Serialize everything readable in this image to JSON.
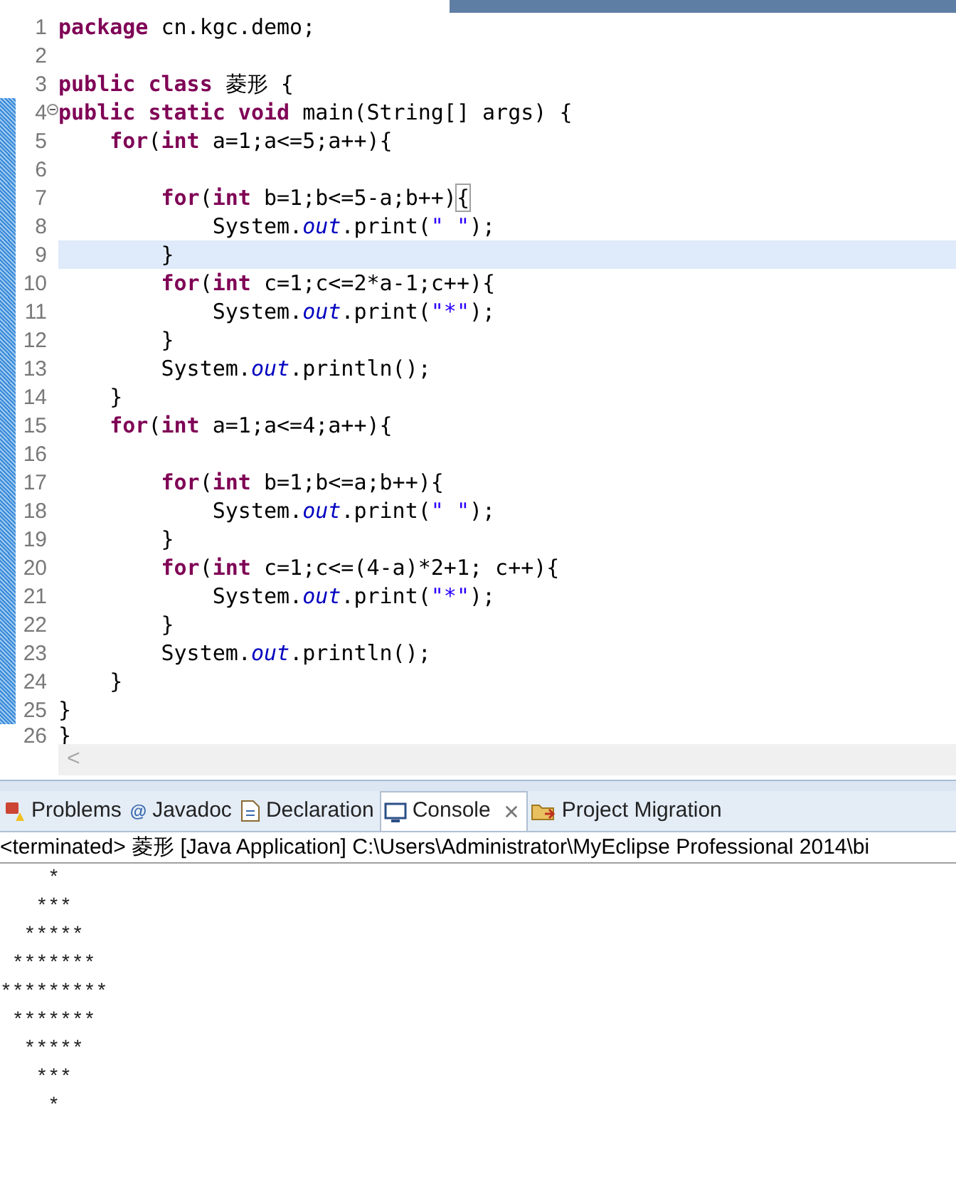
{
  "editor": {
    "lines": [
      {
        "number": "1",
        "current": false,
        "fold": false,
        "marked": false,
        "segments": [
          {
            "kind": "keyword",
            "text": "package"
          },
          {
            "kind": "plain",
            "text": " cn.kgc.demo;"
          }
        ]
      },
      {
        "number": "2",
        "current": false,
        "fold": false,
        "marked": false
      },
      {
        "number": "3",
        "current": false,
        "fold": false,
        "marked": false,
        "segments": [
          {
            "kind": "keyword",
            "text": "public class"
          },
          {
            "kind": "plain",
            "text": " 菱形 {"
          }
        ]
      },
      {
        "number": "4",
        "current": false,
        "fold": true,
        "marked": true,
        "segments": [
          {
            "kind": "keyword",
            "text": "public static void"
          },
          {
            "kind": "plain",
            "text": " main(String[] args) {"
          }
        ]
      },
      {
        "number": "5",
        "current": false,
        "fold": false,
        "marked": true,
        "segments": [
          {
            "kind": "keyword",
            "text": "    for"
          },
          {
            "kind": "plain",
            "text": "("
          },
          {
            "kind": "keyword",
            "text": "int"
          },
          {
            "kind": "plain",
            "text": " a=1;a<=5;a++){"
          }
        ]
      },
      {
        "number": "6",
        "current": false,
        "fold": false,
        "marked": true
      },
      {
        "number": "7",
        "current": false,
        "fold": false,
        "marked": true,
        "segments": [
          {
            "kind": "keyword",
            "text": "        for"
          },
          {
            "kind": "plain",
            "text": "("
          },
          {
            "kind": "keyword",
            "text": "int"
          },
          {
            "kind": "plain",
            "text": " b=1;b<=5-a;b++)"
          },
          {
            "kind": "bracket",
            "text": "{"
          }
        ]
      },
      {
        "number": "8",
        "current": false,
        "fold": false,
        "marked": true,
        "segments": [
          {
            "kind": "plain",
            "text": "            System."
          },
          {
            "kind": "field",
            "text": "out"
          },
          {
            "kind": "plain",
            "text": ".print("
          },
          {
            "kind": "string",
            "text": "\" \""
          },
          {
            "kind": "plain",
            "text": ");"
          }
        ]
      },
      {
        "number": "9",
        "current": true,
        "fold": false,
        "marked": true,
        "segments": [
          {
            "kind": "plain",
            "text": "        }"
          }
        ]
      },
      {
        "number": "10",
        "current": false,
        "fold": false,
        "marked": true,
        "segments": [
          {
            "kind": "keyword",
            "text": "        for"
          },
          {
            "kind": "plain",
            "text": "("
          },
          {
            "kind": "keyword",
            "text": "int"
          },
          {
            "kind": "plain",
            "text": " c=1;c<=2*a-1;c++){"
          }
        ]
      },
      {
        "number": "11",
        "current": false,
        "fold": false,
        "marked": true,
        "segments": [
          {
            "kind": "plain",
            "text": "            System."
          },
          {
            "kind": "field",
            "text": "out"
          },
          {
            "kind": "plain",
            "text": ".print("
          },
          {
            "kind": "string",
            "text": "\"*\""
          },
          {
            "kind": "plain",
            "text": ");"
          }
        ]
      },
      {
        "number": "12",
        "current": false,
        "fold": false,
        "marked": true,
        "segments": [
          {
            "kind": "plain",
            "text": "        }"
          }
        ]
      },
      {
        "number": "13",
        "current": false,
        "fold": false,
        "marked": true,
        "segments": [
          {
            "kind": "plain",
            "text": "        System."
          },
          {
            "kind": "field",
            "text": "out"
          },
          {
            "kind": "plain",
            "text": ".println();"
          }
        ]
      },
      {
        "number": "14",
        "current": false,
        "fold": false,
        "marked": true,
        "segments": [
          {
            "kind": "plain",
            "text": "    }"
          }
        ]
      },
      {
        "number": "15",
        "current": false,
        "fold": false,
        "marked": true,
        "segments": [
          {
            "kind": "keyword",
            "text": "    for"
          },
          {
            "kind": "plain",
            "text": "("
          },
          {
            "kind": "keyword",
            "text": "int"
          },
          {
            "kind": "plain",
            "text": " a=1;a<=4;a++){"
          }
        ]
      },
      {
        "number": "16",
        "current": false,
        "fold": false,
        "marked": true
      },
      {
        "number": "17",
        "current": false,
        "fold": false,
        "marked": true,
        "segments": [
          {
            "kind": "keyword",
            "text": "        for"
          },
          {
            "kind": "plain",
            "text": "("
          },
          {
            "kind": "keyword",
            "text": "int"
          },
          {
            "kind": "plain",
            "text": " b=1;b<=a;b++){"
          }
        ]
      },
      {
        "number": "18",
        "current": false,
        "fold": false,
        "marked": true,
        "segments": [
          {
            "kind": "plain",
            "text": "            System."
          },
          {
            "kind": "field",
            "text": "out"
          },
          {
            "kind": "plain",
            "text": ".print("
          },
          {
            "kind": "string",
            "text": "\" \""
          },
          {
            "kind": "plain",
            "text": ");"
          }
        ]
      },
      {
        "number": "19",
        "current": false,
        "fold": false,
        "marked": true,
        "segments": [
          {
            "kind": "plain",
            "text": "        }"
          }
        ]
      },
      {
        "number": "20",
        "current": false,
        "fold": false,
        "marked": true,
        "segments": [
          {
            "kind": "keyword",
            "text": "        for"
          },
          {
            "kind": "plain",
            "text": "("
          },
          {
            "kind": "keyword",
            "text": "int"
          },
          {
            "kind": "plain",
            "text": " c=1;c<=(4-a)*2+1; c++){"
          }
        ]
      },
      {
        "number": "21",
        "current": false,
        "fold": false,
        "marked": true,
        "segments": [
          {
            "kind": "plain",
            "text": "            System."
          },
          {
            "kind": "field",
            "text": "out"
          },
          {
            "kind": "plain",
            "text": ".print("
          },
          {
            "kind": "string",
            "text": "\"*\""
          },
          {
            "kind": "plain",
            "text": ");"
          }
        ]
      },
      {
        "number": "22",
        "current": false,
        "fold": false,
        "marked": true,
        "segments": [
          {
            "kind": "plain",
            "text": "        }"
          }
        ]
      },
      {
        "number": "23",
        "current": false,
        "fold": false,
        "marked": true,
        "segments": [
          {
            "kind": "plain",
            "text": "        System."
          },
          {
            "kind": "field",
            "text": "out"
          },
          {
            "kind": "plain",
            "text": ".println();"
          }
        ]
      },
      {
        "number": "24",
        "current": false,
        "fold": false,
        "marked": true,
        "segments": [
          {
            "kind": "plain",
            "text": "    }"
          }
        ]
      },
      {
        "number": "25",
        "current": false,
        "fold": false,
        "marked": true,
        "segments": [
          {
            "kind": "plain",
            "text": "}"
          }
        ]
      },
      {
        "number": "26",
        "current": false,
        "fold": false,
        "marked": false,
        "segments": [
          {
            "kind": "plain",
            "text": "}"
          }
        ]
      }
    ],
    "scroll_left": "<"
  },
  "panel": {
    "tabs": [
      {
        "kind": "problems",
        "label": "Problems",
        "selected": false,
        "closable": false
      },
      {
        "kind": "javadoc",
        "icon": "@",
        "label": "Javadoc",
        "selected": false,
        "closable": false
      },
      {
        "kind": "declaration",
        "label": "Declaration",
        "selected": false,
        "closable": false
      },
      {
        "kind": "console",
        "label": "Console",
        "selected": true,
        "closable": true
      },
      {
        "kind": "migration",
        "label": "Project Migration",
        "selected": false,
        "closable": false
      }
    ],
    "console_header": "<terminated> 菱形 [Java Application] C:\\Users\\Administrator\\MyEclipse Professional 2014\\bi",
    "output": "    *\n   ***\n  *****\n *******\n*********\n *******\n  *****\n   ***\n    *"
  }
}
